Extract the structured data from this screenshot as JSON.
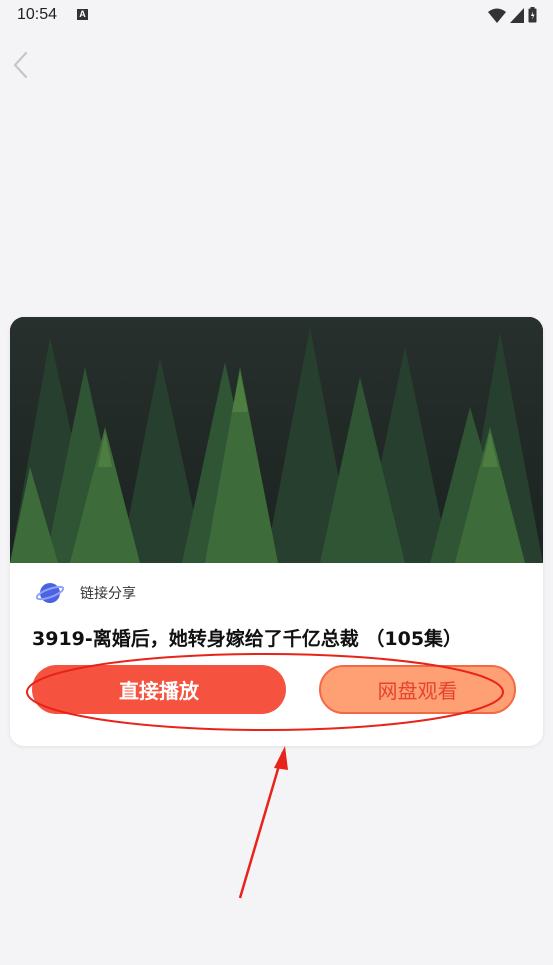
{
  "status_bar": {
    "time": "10:54",
    "notification_icon": "a-icon",
    "notification_glyph": "A",
    "icons": [
      "wifi-icon",
      "signal-icon",
      "battery-icon"
    ]
  },
  "nav": {
    "back_icon": "chevron-left-icon"
  },
  "card": {
    "share_label": "链接分享",
    "share_icon": "planet-icon",
    "title": "3919-离婚后，她转身嫁给了千亿总裁 （105集）",
    "buttons": {
      "play": "直接播放",
      "disk": "网盘观看"
    }
  },
  "colors": {
    "background": "#f4f4f6",
    "play_button": "#f5533f",
    "disk_button": "#ffa074",
    "annotation": "#e8231a"
  }
}
